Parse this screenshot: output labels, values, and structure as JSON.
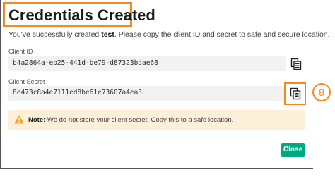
{
  "dialog": {
    "title": "Credentials Created",
    "intro_prefix": "You've successfully created ",
    "intro_name": "test",
    "intro_suffix": ". Please copy the client ID and secret to safe and secure location."
  },
  "client_id": {
    "label": "Client ID",
    "value": "b4a2864a-eb25-441d-be79-d87323bdae68",
    "copy_icon": "copy-icon"
  },
  "client_secret": {
    "label": "Client Secret",
    "value": "8e473c8a4e7111ed8be61e73607a4ea3",
    "copy_icon": "copy-icon"
  },
  "annotation": {
    "step_number": "8",
    "highlight_color": "#f5891f"
  },
  "note": {
    "label": "Note:",
    "text": " We do not store your client secret. Copy this to a safe location.",
    "icon": "warning-icon",
    "background_color": "#fcf0d9"
  },
  "actions": {
    "close_label": "Close",
    "close_color": "#01a982"
  }
}
